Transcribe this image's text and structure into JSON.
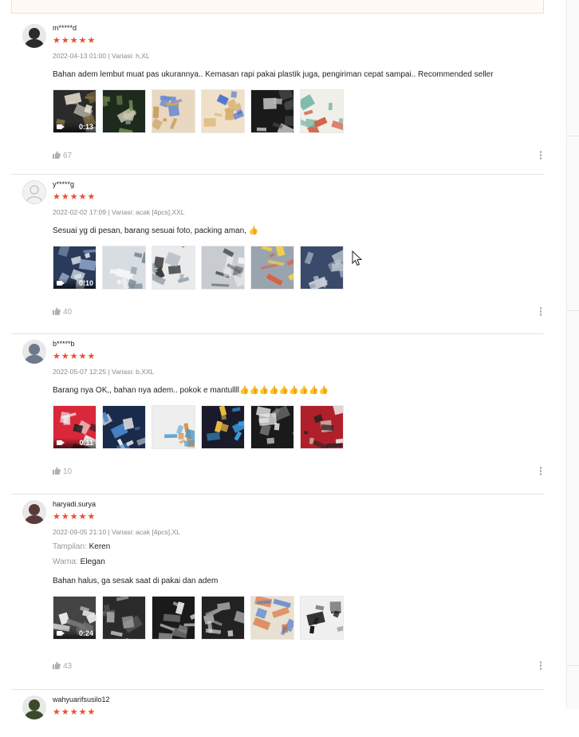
{
  "reviews": [
    {
      "username": "m*****d",
      "rating": 5,
      "meta": "2022-04-13 01:00 | Variasi: h,XL",
      "attributes": [],
      "text": "Bahan adem lembut muat pas ukurannya.. Kemasan rapi pakai plastik juga, pengiriman cepat sampai.. Recommended seller",
      "video_duration": "0:13",
      "likes": "67",
      "avatar_color": "#2b2b2b"
    },
    {
      "username": "y*****g",
      "rating": 5,
      "meta": "2022-02-02 17:09 | Variasi: acak [4pcs],XXL",
      "attributes": [],
      "text": "Sesuai yg di pesan, barang sesuai foto, packing aman, 👍",
      "video_duration": "0:10",
      "likes": "40",
      "avatar_color": "#f2f2f2"
    },
    {
      "username": "b*****b",
      "rating": 5,
      "meta": "2022-05-07 12:25 | Variasi: b,XXL",
      "attributes": [],
      "text": "Barang nya OK,, bahan nya adem.. pokok e mantullll👍👍👍👍👍👍👍👍👍",
      "video_duration": "0:11",
      "likes": "10",
      "avatar_color": "#6d7a8c"
    },
    {
      "username": "haryadi.surya",
      "rating": 5,
      "meta": "2022-09-05 21:10 | Variasi: acak [4pcs],XL",
      "attributes": [
        {
          "label": "Tampilan:",
          "value": "Keren"
        },
        {
          "label": "Warna:",
          "value": "Elegan"
        }
      ],
      "text": "Bahan halus, ga sesak saat di pakai dan adem",
      "video_duration": "0:24",
      "likes": "43",
      "avatar_color": "#5a3a3a"
    },
    {
      "username": "wahyuarifsusilo12",
      "rating": 5,
      "meta": "",
      "attributes": [],
      "text": "",
      "video_duration": "",
      "likes": "",
      "avatar_color": "#3a4a2a"
    }
  ],
  "colors": {
    "star": "#ee4d2d",
    "muted": "#8a8a8a",
    "divider": "#e5e5e5"
  },
  "icons": [
    "video-camera-icon",
    "thumbs-up-icon",
    "more-options-icon",
    "mouse-cursor-icon",
    "star-icon"
  ]
}
